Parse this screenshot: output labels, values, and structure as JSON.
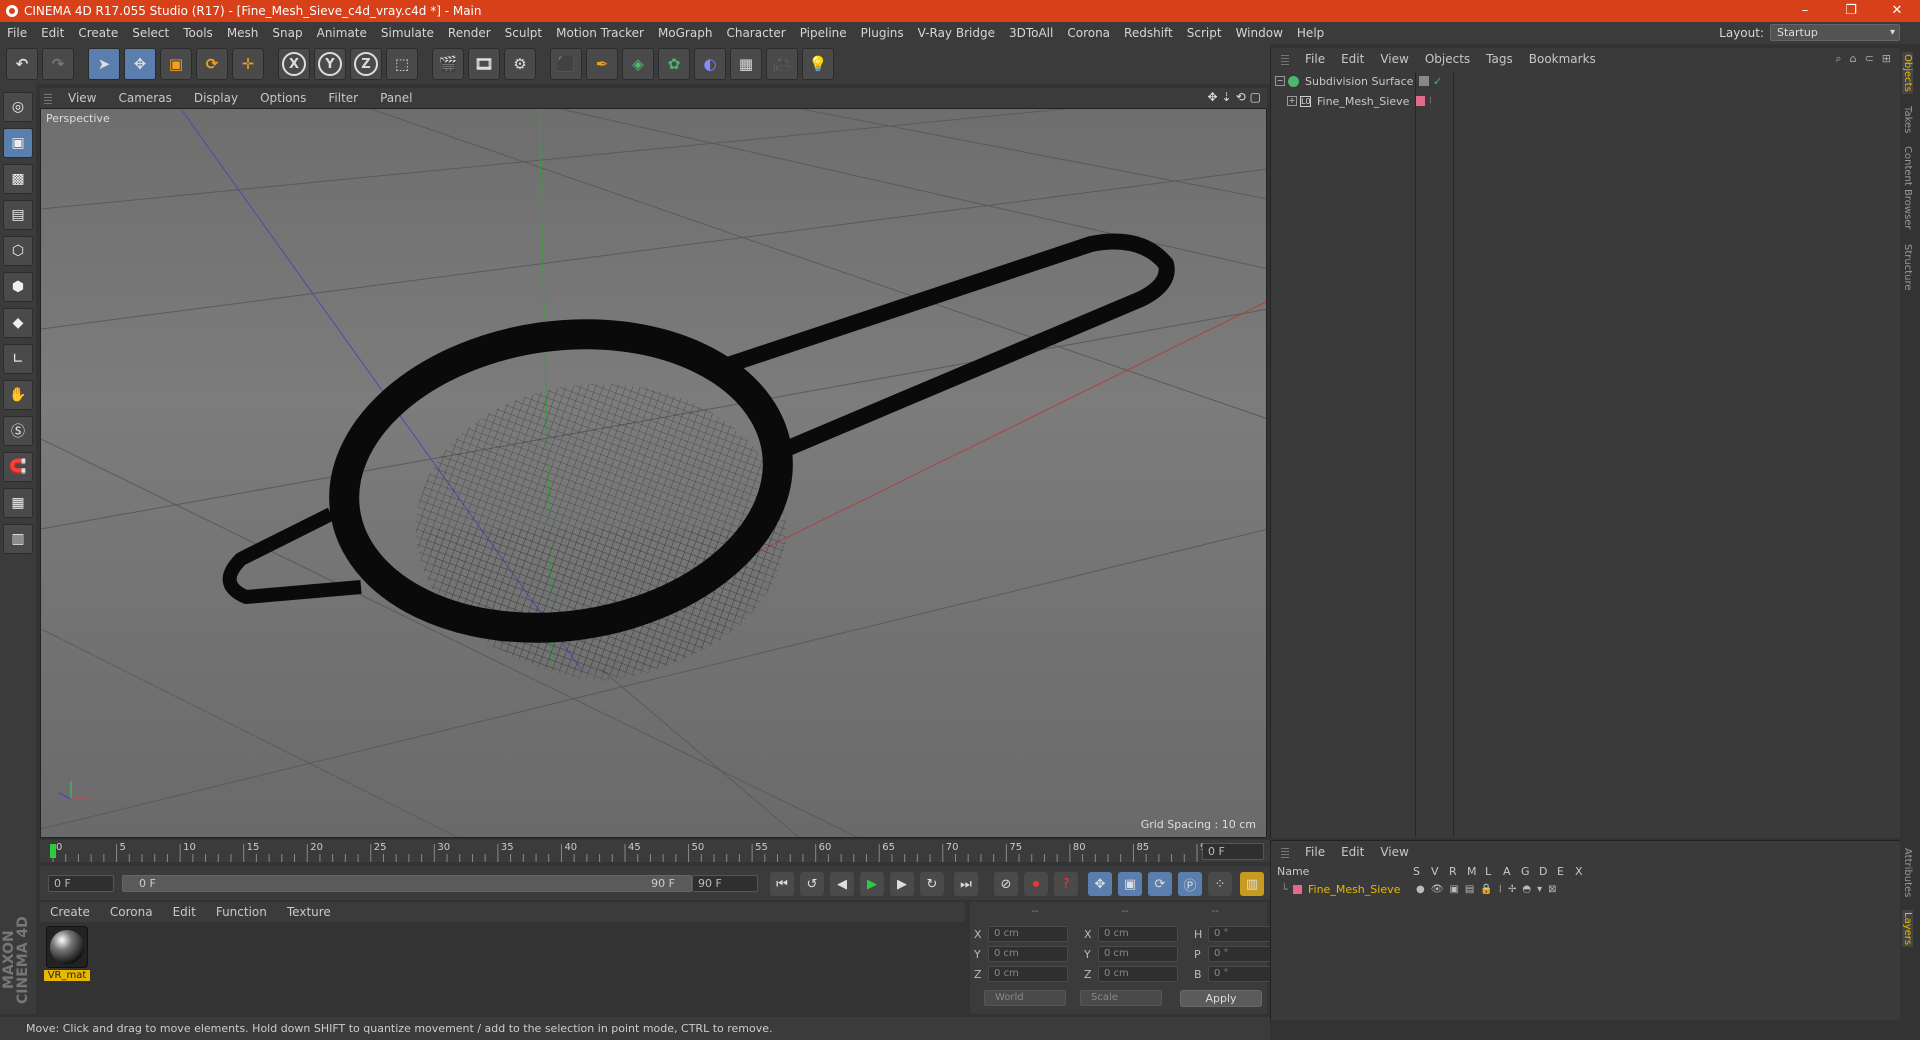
{
  "window": {
    "title": "CINEMA 4D R17.055 Studio (R17) - [Fine_Mesh_Sieve_c4d_vray.c4d *] - Main",
    "min": "–",
    "max": "❐",
    "close": "✕"
  },
  "menu": [
    "File",
    "Edit",
    "Create",
    "Select",
    "Tools",
    "Mesh",
    "Snap",
    "Animate",
    "Simulate",
    "Render",
    "Sculpt",
    "Motion Tracker",
    "MoGraph",
    "Character",
    "Pipeline",
    "Plugins",
    "V-Ray Bridge",
    "3DToAll",
    "Corona",
    "Redshift",
    "Script",
    "Window",
    "Help"
  ],
  "layout": {
    "label": "Layout:",
    "value": "Startup"
  },
  "toolbar": {
    "x": "X",
    "y": "Y",
    "z": "Z"
  },
  "viewport": {
    "menu": [
      "View",
      "Cameras",
      "Display",
      "Options",
      "Filter",
      "Panel"
    ],
    "camera_label": "Perspective",
    "grid_spacing": "Grid Spacing : 10 cm"
  },
  "timeline": {
    "ticks": [
      "0",
      "5",
      "10",
      "15",
      "20",
      "25",
      "30",
      "35",
      "40",
      "45",
      "50",
      "55",
      "60",
      "65",
      "70",
      "75",
      "80",
      "85",
      "90"
    ],
    "current_frame": "0 F",
    "start_frame": "0 F",
    "range_start": "0 F",
    "range_end": "90 F",
    "end_frame": "90 F"
  },
  "material_panel": {
    "menu": [
      "Create",
      "Corona",
      "Edit",
      "Function",
      "Texture"
    ],
    "material_name": "VR_mat"
  },
  "coordinates": {
    "headers": [
      "--",
      "--",
      "--"
    ],
    "rows": [
      {
        "a": "X",
        "av": "0 cm",
        "b": "X",
        "bv": "0 cm",
        "c": "H",
        "cv": "0 °"
      },
      {
        "a": "Y",
        "av": "0 cm",
        "b": "Y",
        "bv": "0 cm",
        "c": "P",
        "cv": "0 °"
      },
      {
        "a": "Z",
        "av": "0 cm",
        "b": "Z",
        "bv": "0 cm",
        "c": "B",
        "cv": "0 °"
      }
    ],
    "mode1": "World",
    "mode2": "Scale",
    "apply": "Apply"
  },
  "status": "Move: Click and drag to move elements. Hold down SHIFT to quantize movement / add to the selection in point mode, CTRL to remove.",
  "objects_panel": {
    "menu": [
      "File",
      "Edit",
      "View",
      "Objects",
      "Tags",
      "Bookmarks"
    ],
    "items": [
      {
        "name": "Subdivision Surface"
      },
      {
        "name": "Fine_Mesh_Sieve"
      }
    ]
  },
  "layers_panel": {
    "menu": [
      "File",
      "Edit",
      "View"
    ],
    "columns": [
      "Name",
      "S",
      "V",
      "R",
      "M",
      "L",
      "A",
      "G",
      "D",
      "E",
      "X"
    ],
    "row": "Fine_Mesh_Sieve"
  },
  "side_tabs": [
    "Objects",
    "Takes",
    "Content Browser",
    "Structure",
    "Attributes",
    "Layers"
  ],
  "branding": "MAXON CINEMA 4D",
  "colors": {
    "title_bar": "#d8401a",
    "selected_icon": "#5a7fae",
    "highlight_text": "#e8b800"
  }
}
